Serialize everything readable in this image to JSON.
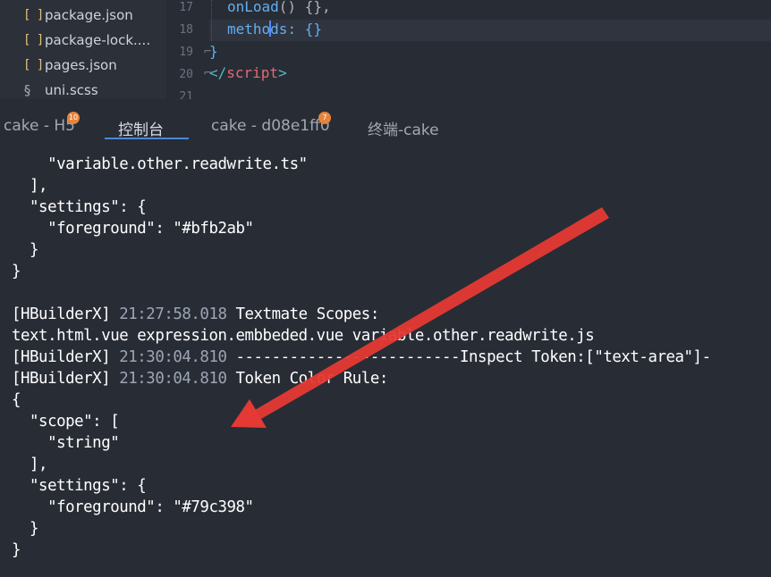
{
  "explorer": {
    "files": [
      {
        "icon": "json-file-icon",
        "glyph": "[ ]",
        "name": "package.json"
      },
      {
        "icon": "json-file-icon",
        "glyph": "[ ]",
        "name": "package-lock...."
      },
      {
        "icon": "json-file-icon",
        "glyph": "[ ]",
        "name": "pages.json"
      },
      {
        "icon": "scss-file-icon",
        "glyph": "§",
        "name": "uni.scss"
      }
    ]
  },
  "editor": {
    "line_numbers": [
      "17",
      "18",
      "19",
      "20",
      "21"
    ],
    "lines": {
      "l17_key": "onLoad",
      "l17_rest": "() {},",
      "l18_key_a": "metho",
      "l18_key_b": "ds",
      "l18_rest": ": {}",
      "l19": "}",
      "l20_open": "</",
      "l20_tag": "script",
      "l20_close": ">"
    }
  },
  "panel": {
    "tabs": [
      {
        "label": "cake - H5",
        "badge": "10"
      },
      {
        "label": "控制台",
        "badge": ""
      },
      {
        "label": "cake - d08e1ff0",
        "badge": "7"
      },
      {
        "label": "终端-cake",
        "badge": ""
      }
    ],
    "active_tab": "控制台"
  },
  "console": {
    "lines": [
      {
        "ts": "",
        "text": "    \"variable.other.readwrite.ts\""
      },
      {
        "ts": "",
        "text": "  ],"
      },
      {
        "ts": "",
        "text": "  \"settings\": {"
      },
      {
        "ts": "",
        "text": "    \"foreground\": \"#bfb2ab\""
      },
      {
        "ts": "",
        "text": "  }"
      },
      {
        "ts": "",
        "text": "}"
      },
      {
        "ts": "",
        "text": ""
      },
      {
        "prefix": "[HBuilderX] ",
        "ts": "21:27:58.018",
        "text": " Textmate Scopes:"
      },
      {
        "ts": "",
        "text": "text.html.vue expression.embbeded.vue variable.other.readwrite.js"
      },
      {
        "prefix": "[HBuilderX] ",
        "ts": "21:30:04.810",
        "text": " -------------------------Inspect Token:[\"text-area\"]-"
      },
      {
        "prefix": "[HBuilderX] ",
        "ts": "21:30:04.810",
        "text": " Token Color Rule:"
      },
      {
        "ts": "",
        "text": "{"
      },
      {
        "ts": "",
        "text": "  \"scope\": ["
      },
      {
        "ts": "",
        "text": "    \"string\""
      },
      {
        "ts": "",
        "text": "  ],"
      },
      {
        "ts": "",
        "text": "  \"settings\": {"
      },
      {
        "ts": "",
        "text": "    \"foreground\": \"#79c398\""
      },
      {
        "ts": "",
        "text": "  }"
      },
      {
        "ts": "",
        "text": "}"
      }
    ]
  },
  "colors": {
    "background": "#282c35",
    "annotation_arrow": "#e53935",
    "tab_underline": "#4a8ad8",
    "badge": "#e8833a"
  }
}
